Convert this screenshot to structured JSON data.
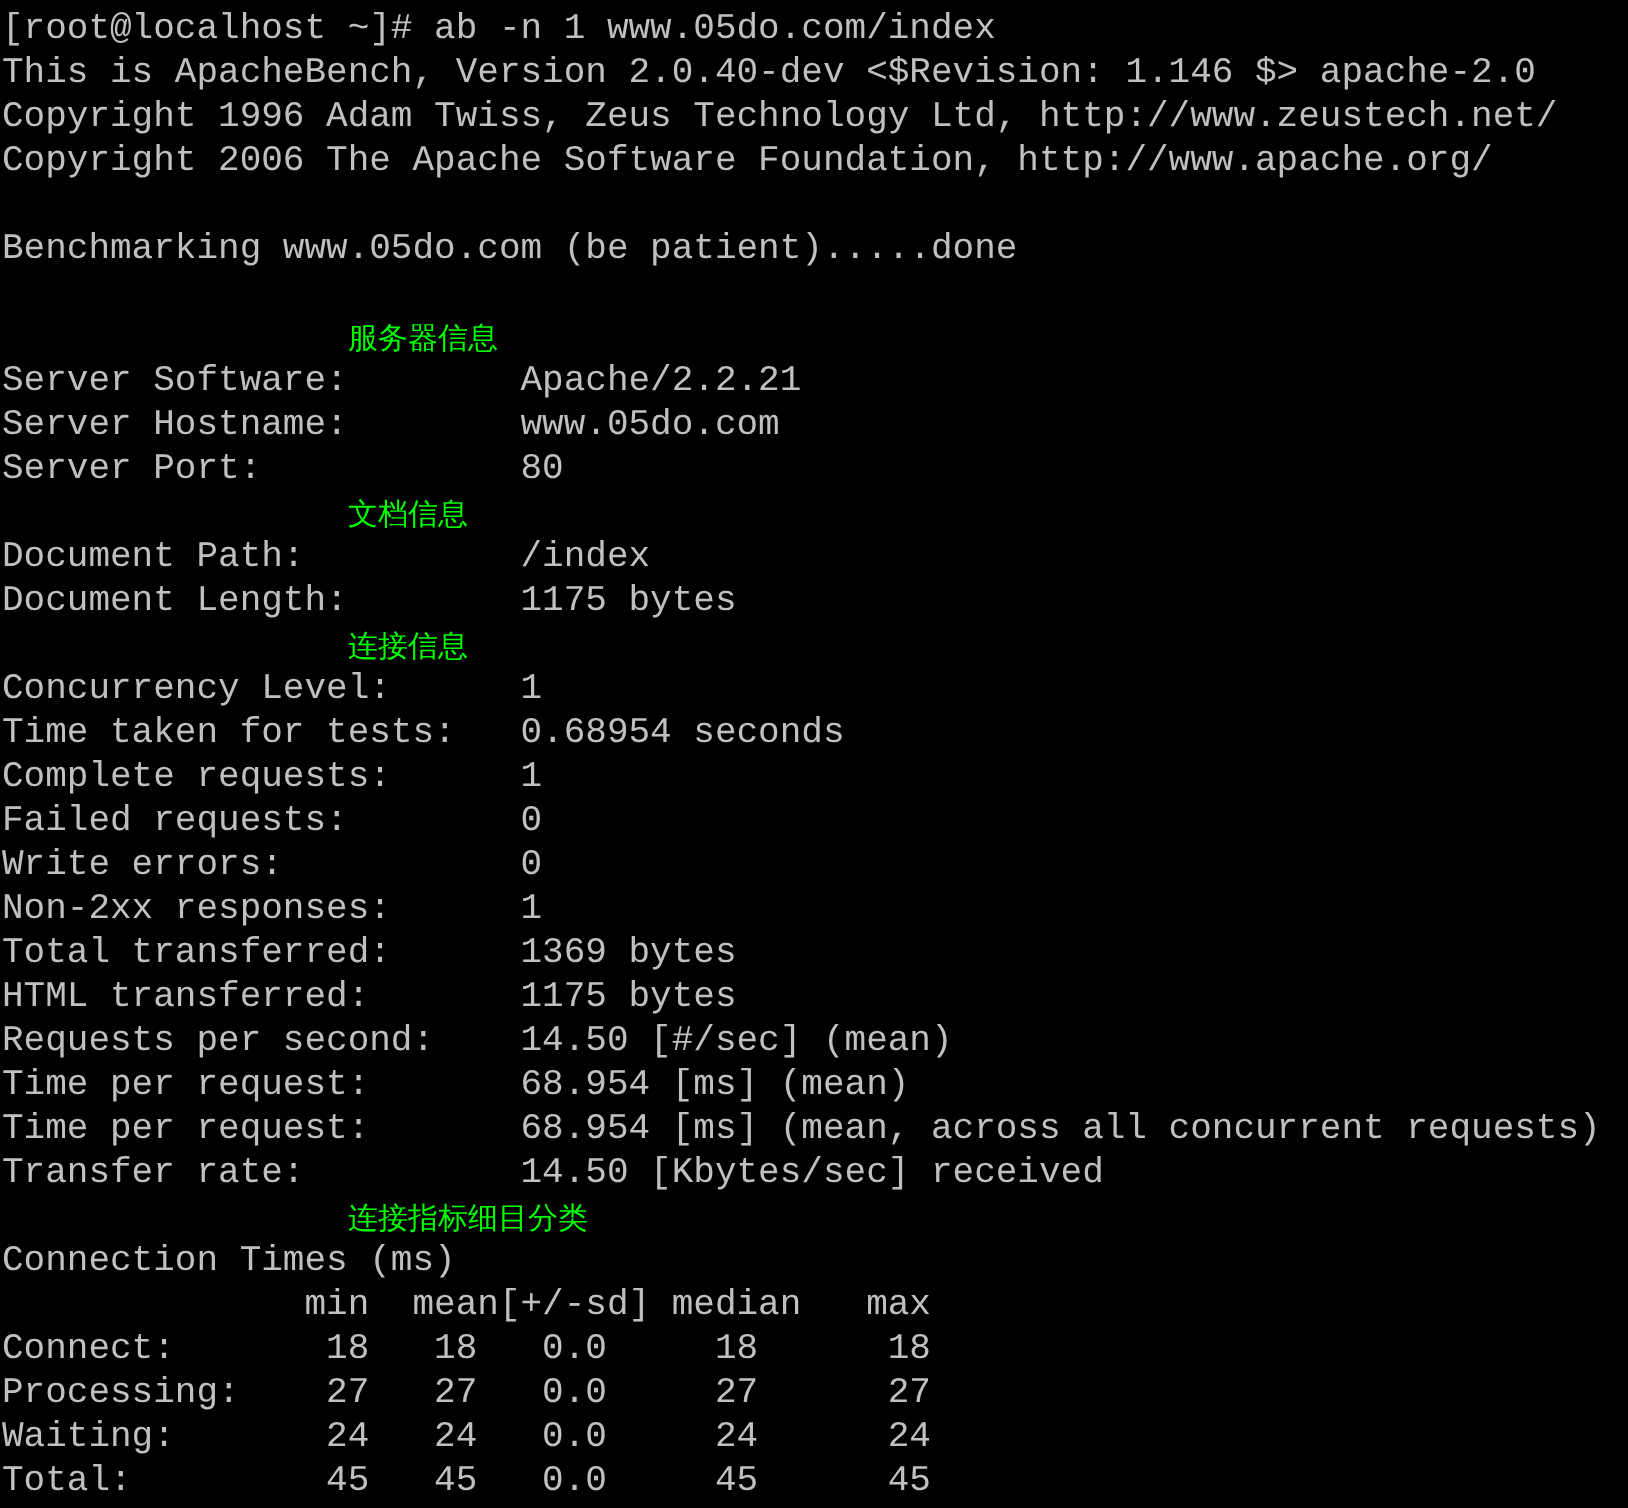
{
  "lines": [
    {
      "kind": "text",
      "text": "[root@localhost ~]# ab -n 1 www.05do.com/index"
    },
    {
      "kind": "text",
      "text": "This is ApacheBench, Version 2.0.40-dev <$Revision: 1.146 $> apache-2.0"
    },
    {
      "kind": "text",
      "text": "Copyright 1996 Adam Twiss, Zeus Technology Ltd, http://www.zeustech.net/"
    },
    {
      "kind": "text",
      "text": "Copyright 2006 The Apache Software Foundation, http://www.apache.org/"
    },
    {
      "kind": "blank"
    },
    {
      "kind": "text",
      "text": "Benchmarking www.05do.com (be patient).....done"
    },
    {
      "kind": "blank"
    },
    {
      "kind": "heading",
      "text": "服务器信息"
    },
    {
      "kind": "field",
      "label": "Server Software:",
      "value": "Apache/2.2.21"
    },
    {
      "kind": "field",
      "label": "Server Hostname:",
      "value": "www.05do.com"
    },
    {
      "kind": "field",
      "label": "Server Port:",
      "value": "80"
    },
    {
      "kind": "heading",
      "text": "文档信息"
    },
    {
      "kind": "field",
      "label": "Document Path:",
      "value": "/index"
    },
    {
      "kind": "field",
      "label": "Document Length:",
      "value": "1175 bytes"
    },
    {
      "kind": "heading",
      "text": "连接信息"
    },
    {
      "kind": "field",
      "label": "Concurrency Level:",
      "value": "1"
    },
    {
      "kind": "field",
      "label": "Time taken for tests:",
      "value": "0.68954 seconds"
    },
    {
      "kind": "field",
      "label": "Complete requests:",
      "value": "1"
    },
    {
      "kind": "field",
      "label": "Failed requests:",
      "value": "0"
    },
    {
      "kind": "field",
      "label": "Write errors:",
      "value": "0"
    },
    {
      "kind": "field",
      "label": "Non-2xx responses:",
      "value": "1"
    },
    {
      "kind": "field",
      "label": "Total transferred:",
      "value": "1369 bytes"
    },
    {
      "kind": "field",
      "label": "HTML transferred:",
      "value": "1175 bytes"
    },
    {
      "kind": "field",
      "label": "Requests per second:",
      "value": "14.50 [#/sec] (mean)"
    },
    {
      "kind": "field",
      "label": "Time per request:",
      "value": "68.954 [ms] (mean)"
    },
    {
      "kind": "field",
      "label": "Time per request:",
      "value": "68.954 [ms] (mean, across all concurrent requests)"
    },
    {
      "kind": "field",
      "label": "Transfer rate:",
      "value": "14.50 [Kbytes/sec] received"
    },
    {
      "kind": "heading",
      "text": "连接指标细目分类"
    },
    {
      "kind": "text",
      "text": "Connection Times (ms)"
    },
    {
      "kind": "text",
      "text": "              min  mean[+/-sd] median   max"
    },
    {
      "kind": "text",
      "text": "Connect:       18   18   0.0     18      18"
    },
    {
      "kind": "text",
      "text": "Processing:    27   27   0.0     27      27"
    },
    {
      "kind": "text",
      "text": "Waiting:       24   24   0.0     24      24"
    },
    {
      "kind": "text",
      "text": "Total:         45   45   0.0     45      45"
    }
  ]
}
